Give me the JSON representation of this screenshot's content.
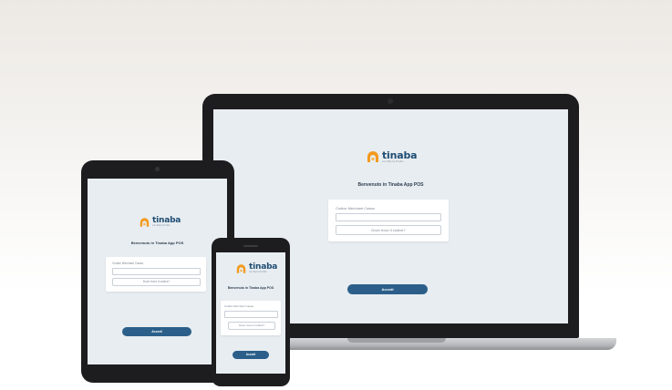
{
  "app": {
    "brand_name": "tinaba",
    "brand_tagline": "con Banca Profilo",
    "welcome": "Benvenuto in Tinaba App POS",
    "field_label": "Codice Merchant Cassa",
    "field_value": "",
    "code_link": "Dove trovo il codice?",
    "login_button": "Accedi"
  },
  "colors": {
    "accent": "#2b5f8a",
    "logo_orange": "#f39a1e",
    "screen_bg": "#e8edf1"
  }
}
